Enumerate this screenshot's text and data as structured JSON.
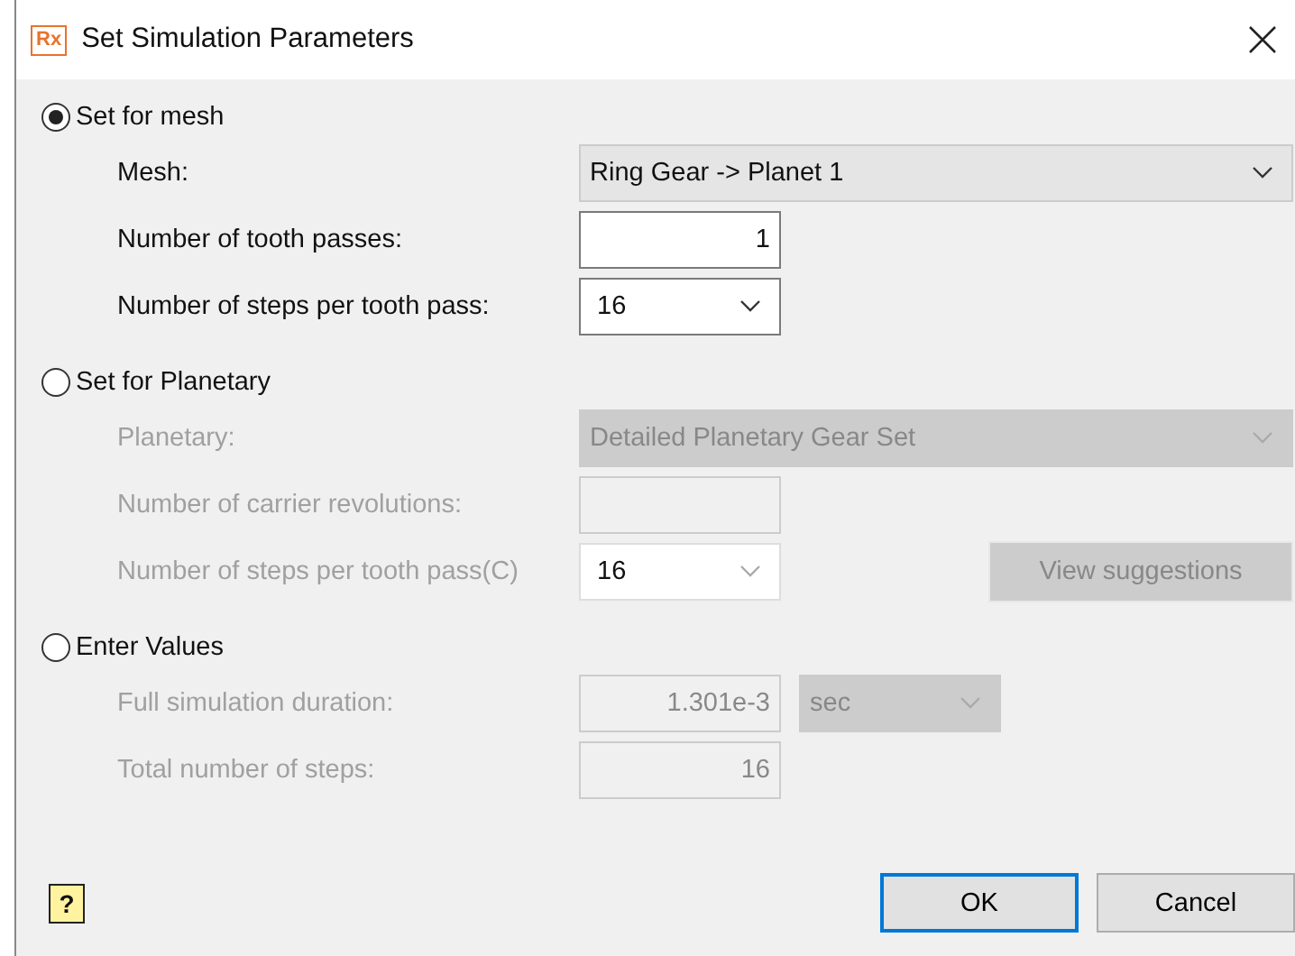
{
  "window": {
    "title": "Set Simulation Parameters",
    "logo": "Rx"
  },
  "sections": [
    {
      "label": "Set for mesh",
      "selected": true,
      "rows": [
        {
          "label": "Mesh:",
          "field": {
            "kind": "select",
            "value": "Ring Gear -> Planet 1",
            "disabled": false
          }
        },
        {
          "label": "Number of tooth passes:",
          "field": {
            "kind": "number",
            "value": "1",
            "disabled": false
          }
        },
        {
          "label": "Number of steps per tooth pass:",
          "field": {
            "kind": "combo",
            "value": "16",
            "disabled": false
          }
        }
      ]
    },
    {
      "label": "Set for Planetary",
      "selected": false,
      "rows": [
        {
          "label": "Planetary:",
          "field": {
            "kind": "select",
            "value": "Detailed Planetary Gear Set",
            "disabled": true
          }
        },
        {
          "label": "Number of carrier revolutions:",
          "field": {
            "kind": "number",
            "disabled": true
          }
        },
        {
          "label": "Number of steps per tooth pass(C)",
          "field": {
            "kind": "combo",
            "value": "16",
            "disabled": true
          },
          "button": {
            "label": "View suggestions",
            "disabled": true
          }
        }
      ]
    },
    {
      "label": "Enter Values",
      "selected": false,
      "rows": [
        {
          "label": "Full simulation duration:",
          "field": {
            "kind": "number",
            "value": "1.301e-3",
            "disabled": true
          },
          "unit": {
            "value": "sec",
            "disabled": true
          }
        },
        {
          "label": "Total number of steps:",
          "field": {
            "kind": "number",
            "value": "16",
            "disabled": true
          }
        }
      ]
    }
  ],
  "footer": {
    "help": "?",
    "ok": "OK",
    "cancel": "Cancel"
  }
}
